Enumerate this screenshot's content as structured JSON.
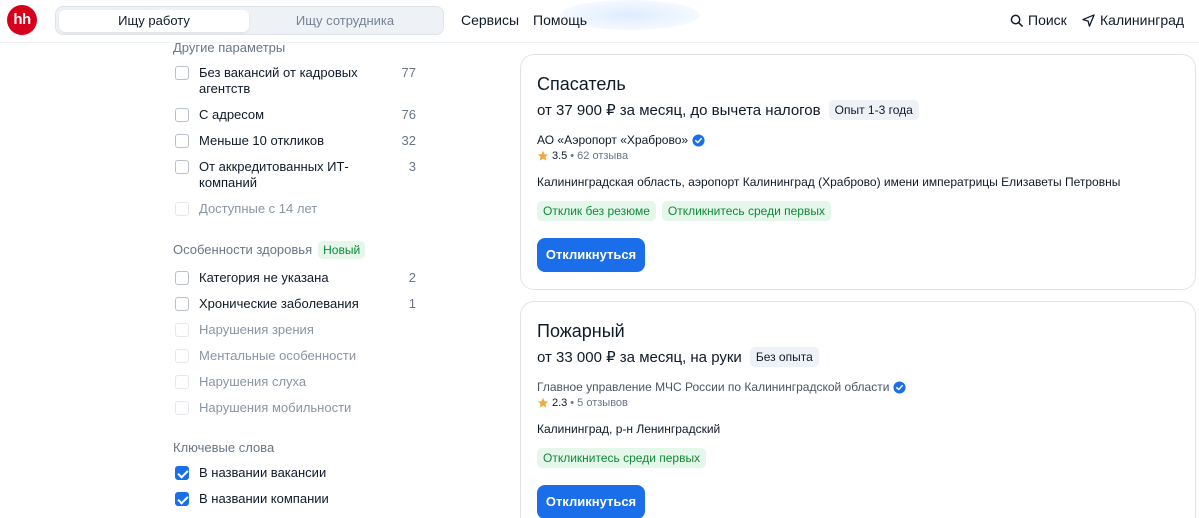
{
  "header": {
    "logo": "hh",
    "mode_tabs": [
      "Ищу работу",
      "Ищу сотрудника"
    ],
    "nav": [
      "Сервисы",
      "Помощь"
    ],
    "search_label": "Поиск",
    "city_label": "Калининград"
  },
  "sidebar": {
    "other_params": {
      "title": "Другие параметры",
      "items": [
        {
          "label": "Без вакансий от кадровых агентств",
          "count": "77",
          "checked": false,
          "disabled": false
        },
        {
          "label": "С адресом",
          "count": "76",
          "checked": false,
          "disabled": false
        },
        {
          "label": "Меньше 10 откликов",
          "count": "32",
          "checked": false,
          "disabled": false
        },
        {
          "label": "От аккредитованных ИТ-компаний",
          "count": "3",
          "checked": false,
          "disabled": false
        },
        {
          "label": "Доступные с 14 лет",
          "count": "",
          "checked": false,
          "disabled": true
        }
      ]
    },
    "health": {
      "title": "Особенности здоровья",
      "badge": "Новый",
      "items": [
        {
          "label": "Категория не указана",
          "count": "2",
          "checked": false,
          "disabled": false
        },
        {
          "label": "Хронические заболевания",
          "count": "1",
          "checked": false,
          "disabled": false
        },
        {
          "label": "Нарушения зрения",
          "count": "",
          "checked": false,
          "disabled": true
        },
        {
          "label": "Ментальные особенности",
          "count": "",
          "checked": false,
          "disabled": true
        },
        {
          "label": "Нарушения слуха",
          "count": "",
          "checked": false,
          "disabled": true
        },
        {
          "label": "Нарушения мобильности",
          "count": "",
          "checked": false,
          "disabled": true
        }
      ]
    },
    "keywords": {
      "title": "Ключевые слова",
      "items": [
        {
          "label": "В названии вакансии",
          "checked": true
        },
        {
          "label": "В названии компании",
          "checked": true
        }
      ]
    }
  },
  "vacancies": [
    {
      "title": "Спасатель",
      "salary": "от 37 900 ₽ за месяц, до вычета налогов",
      "experience": "Опыт 1-3 года",
      "company": "АО «Аэропорт «Храброво»",
      "rating": "3.5",
      "reviews": "62 отзыва",
      "address": "Калининградская область, аэропорт Калининград (Храброво) имени императрицы Елизаветы Петровны",
      "tags": [
        "Отклик без резюме",
        "Откликнитесь среди первых"
      ],
      "apply_label": "Откликнуться"
    },
    {
      "title": "Пожарный",
      "salary": "от 33 000 ₽ за месяц, на руки",
      "experience": "Без опыта",
      "company": "Главное управление МЧС России по Калининградской области",
      "rating": "2.3",
      "reviews": "5 отзывов",
      "address": "Калининград, р-н Ленинградский",
      "tags": [
        "Откликнитесь среди первых"
      ],
      "apply_label": "Откликнуться"
    }
  ],
  "icons": {
    "search": "search-icon",
    "location": "location-arrow-icon",
    "star": "star-icon",
    "verified": "verified-check-icon"
  },
  "colors": {
    "brand": "#d6001c",
    "primary_button": "#1a6eea",
    "tag_bg": "#e5f6ea",
    "tag_text": "#0f8a38"
  }
}
